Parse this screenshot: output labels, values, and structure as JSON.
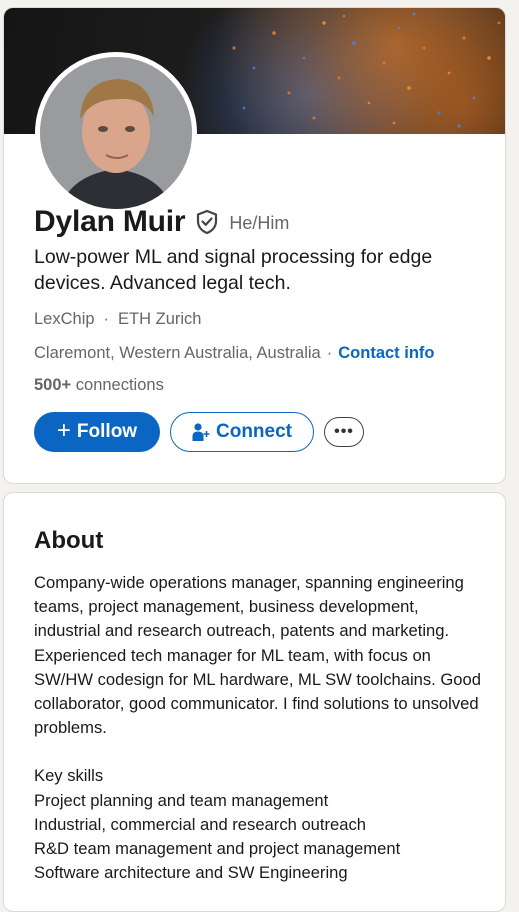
{
  "profile": {
    "name": "Dylan Muir",
    "pronouns": "He/Him",
    "headline": "Low-power ML and signal processing for edge devices. Advanced legal tech.",
    "organizations": [
      "LexChip",
      "ETH Zurich"
    ],
    "location": "Claremont, Western Australia, Australia",
    "contact_label": "Contact info",
    "connections_count": "500+",
    "connections_label": "connections",
    "verified_icon": "shield-check-icon",
    "separator": "·"
  },
  "actions": {
    "follow_label": "Follow",
    "connect_label": "Connect",
    "more_label": "•••"
  },
  "about": {
    "title": "About",
    "paragraph": "Company-wide operations manager, spanning engineering teams, project management, business development, industrial and research outreach, patents and marketing. Experienced tech manager for ML team, with focus on SW/HW codesign for ML hardware, ML SW toolchains. Good collaborator, good communicator. I find solutions to unsolved problems.",
    "skills_heading": "Key skills",
    "skills": [
      "Project planning and team management",
      "Industrial, commercial and research outreach",
      "R&D team management and project management",
      "Software architecture and SW Engineering"
    ]
  },
  "colors": {
    "accent": "#0a66c2",
    "text_secondary": "#666666",
    "background": "#f4f2ee"
  }
}
